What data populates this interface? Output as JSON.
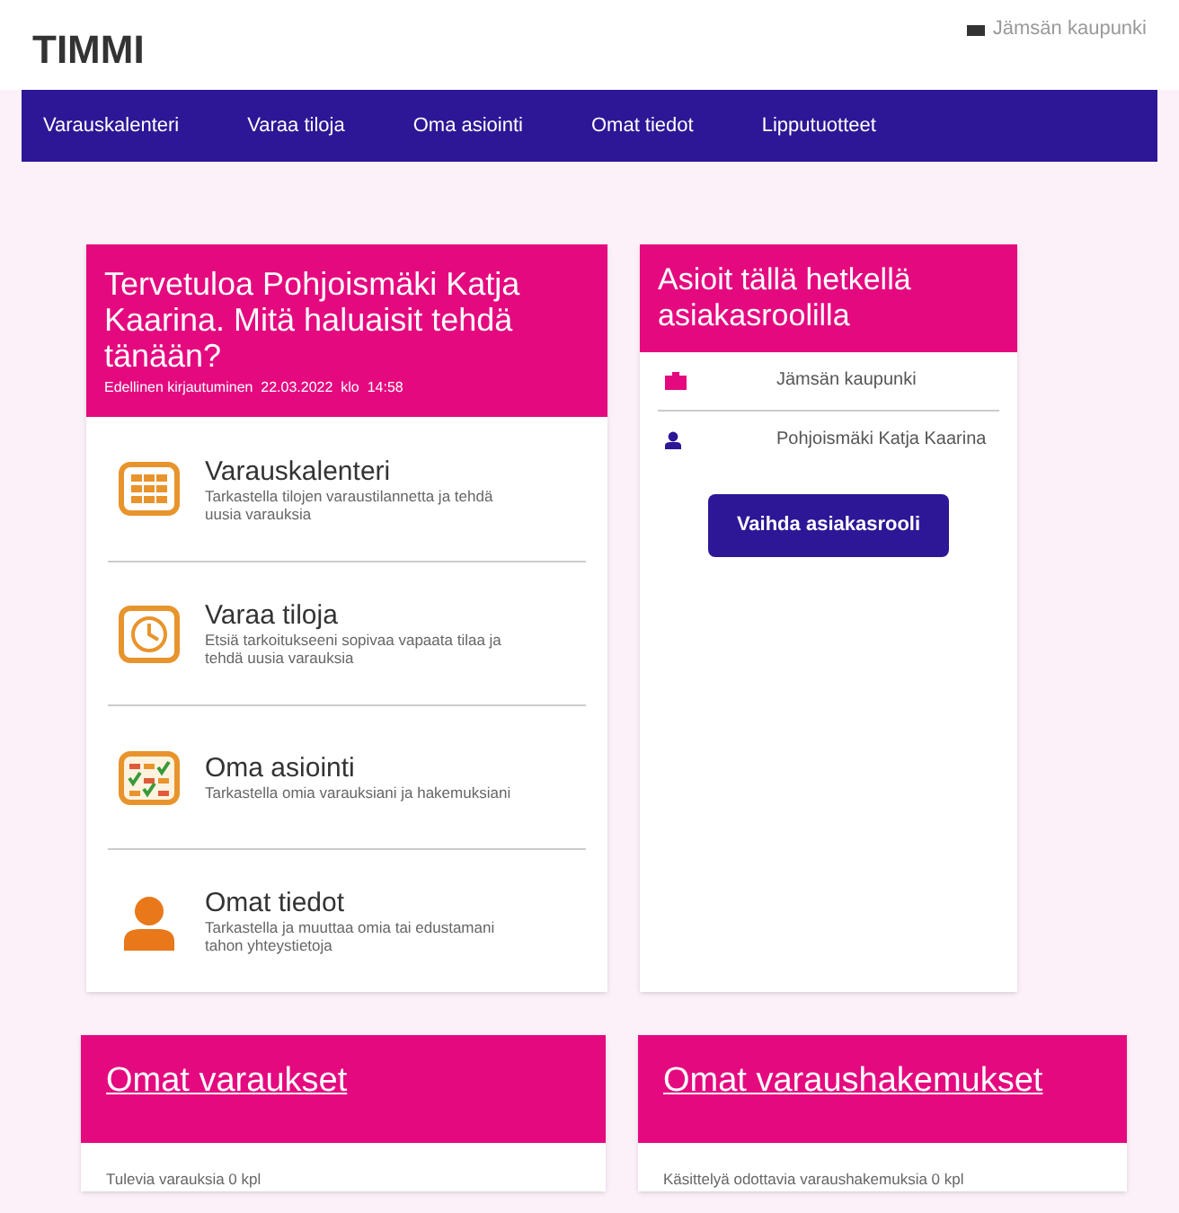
{
  "header": {
    "logo": "TIMMI",
    "user": "Jämsän kaupunki"
  },
  "nav": [
    "Varauskalenteri",
    "Varaa tiloja",
    "Oma asiointi",
    "Omat tiedot",
    "Lipputuotteet"
  ],
  "welcome": {
    "title": "Tervetuloa Pohjoismäki Katja Kaarina. Mitä haluaisit tehdä tänään?",
    "last_login": "Edellinen kirjautuminen  22.03.2022  klo  14:58",
    "items": [
      {
        "title": "Varauskalenteri",
        "description": "Tarkastella tilojen varaustilannetta ja tehdä uusia varauksia"
      },
      {
        "title": "Varaa tiloja",
        "description": "Etsiä tarkoitukseeni sopivaa vapaata tilaa ja tehdä uusia varauksia"
      },
      {
        "title": "Oma asiointi",
        "description": "Tarkastella omia varauksiani ja hakemuksiani"
      },
      {
        "title": "Omat tiedot",
        "description": "Tarkastella ja muuttaa omia tai edustamani tahon yhteystietoja"
      }
    ]
  },
  "role": {
    "title": "Asioit tällä hetkellä asiakasroolilla",
    "roles": [
      "Jämsän kaupunki",
      "Pohjoismäki Katja Kaarina"
    ],
    "button": "Vaihda asiakasrooli"
  },
  "summaries": [
    {
      "title": "Omat varaukset",
      "text": "Tulevia varauksia 0 kpl"
    },
    {
      "title": "Omat varaushakemukset",
      "text": "Käsittelyä odottavia varaushakemuksia 0 kpl"
    }
  ]
}
